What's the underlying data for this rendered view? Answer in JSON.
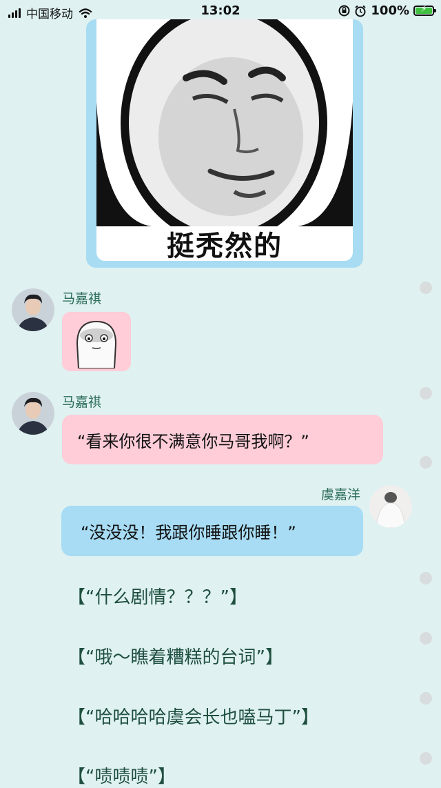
{
  "status_bar": {
    "carrier": "中国移动",
    "time": "13:02",
    "battery_percent": "100%",
    "battery_level": 1.0,
    "icons": [
      "signal-icon",
      "wifi-icon",
      "rotation-lock-icon",
      "alarm-icon",
      "battery-charging-icon"
    ]
  },
  "meme": {
    "caption": "挺秃然的"
  },
  "messages": [
    {
      "sender": "马嘉祺",
      "type": "sticker"
    },
    {
      "sender": "马嘉祺",
      "type": "text",
      "text": "“看来你很不满意你马哥我啊？”"
    },
    {
      "sender": "虞嘉洋",
      "type": "text",
      "text": "“没没没！我跟你睡跟你睡！”"
    }
  ],
  "actions": [
    "【“什么剧情？？？”】",
    "【“哦～瞧着糟糕的台词”】",
    "【“哈哈哈哈虞会长也嗑马丁”】",
    "【“啧啧啧”】"
  ],
  "colors": {
    "background": "#dff1f1",
    "pink_bubble": "#ffcdd8",
    "blue_bubble": "#a7dcf4",
    "name_text": "#2a6b57",
    "action_text": "#1f4f3f"
  }
}
